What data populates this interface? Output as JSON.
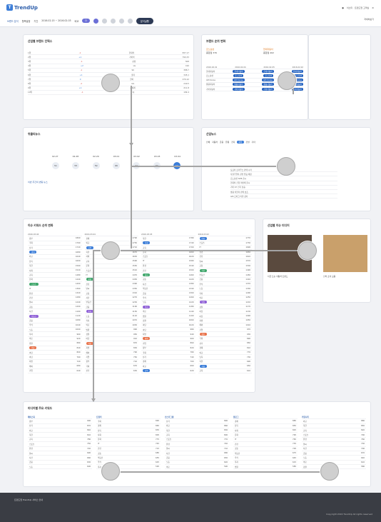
{
  "header": {
    "app_name": "TrendUp",
    "user_text": "이소미 · 트렌드업 고객님",
    "right_link": "자세히보기",
    "filter_category": "브랜드 분석",
    "filter_sub": "항목설정",
    "date_label": "기간",
    "date_range": "2016.02.15 ~ 2016.02.03",
    "ref_label": "비교",
    "analyze_btn": "분석실행"
  },
  "brand_card": {
    "title": "산업별 브랜드 인덱스",
    "rows": [
      {
        "rank": "1위",
        "change": "-1",
        "brand": "현대차",
        "score": "837.17"
      },
      {
        "rank": "2위",
        "change": "+1",
        "brand": "기아차",
        "score": "790.33"
      },
      {
        "rank": "3위",
        "change": "-1",
        "brand": "삼성",
        "score": "508"
      },
      {
        "rank": "4위",
        "change": "+2",
        "brand": "LG",
        "score": "410"
      },
      {
        "rank": "5위",
        "change": "-1",
        "brand": "SK",
        "score": "388.7"
      },
      {
        "rank": "6위",
        "change": "+1",
        "brand": "롯데",
        "score": "345.1"
      },
      {
        "rank": "7위",
        "change": "0",
        "brand": "한화",
        "score": "279.12"
      },
      {
        "rank": "8위",
        "change": "-2",
        "brand": "GS",
        "score": "240.5"
      },
      {
        "rank": "9위",
        "change": "+1",
        "brand": "신세계",
        "score": "211.8"
      },
      {
        "rank": "10위",
        "change": "-1",
        "brand": "CJ",
        "score": "199.4"
      }
    ]
  },
  "compare_card": {
    "title": "브랜드 순위 변화",
    "brand_a": "르노삼성",
    "score_a": "종합점 376",
    "brand_b": "현대자동차",
    "score_b": "종합점 402",
    "cols": [
      "2016.02.01",
      "2016.02.04",
      "2016.02.05",
      "2016.02.02"
    ],
    "rows": [
      "현대자동차",
      "르노삼성",
      "GM Korea",
      "쌍용자동차",
      "기아자동차"
    ]
  },
  "keyword_card": {
    "title": "위클리뉴스",
    "chart_labels": [
      "02.27",
      "02.28",
      "02.29",
      "03.01",
      "03.02",
      "03.03",
      "03.04"
    ],
    "values": [
      "51",
      "55",
      "59",
      "66",
      "41",
      "30",
      "11"
    ],
    "text_head": "이번 주간의 변동 뉴스"
  },
  "news_card": {
    "title": "산업뉴스",
    "tabs": [
      "전체",
      "자동차",
      "금융",
      "유통",
      "전자",
      "화학",
      "건설",
      "기타"
    ],
    "items": [
      "토요타 프리우스 판매 시작",
      "자율주행차 관련 발표 예정",
      "르노삼성 SM6 출시",
      "현대차 신형 아반떼 출시",
      "기아 K7 인기 상승",
      "쌍용 티볼리 판매 호조",
      "GM 스파크 리콜 공지"
    ]
  },
  "rank_card": {
    "title": "이슈 키워드 순위 변화",
    "cols": [
      "2016.03.04",
      "2016.03.04",
      "2016.03.03",
      "2016.03.02"
    ]
  },
  "media_card": {
    "title": "산업별 이슈 미디어",
    "cap_a": "지금 뜨는 자동차 트렌드",
    "cap_b": "신차 소식 모음"
  },
  "bottom_card": {
    "title": "미디어별 주요 키워드",
    "groups": [
      "페이스북",
      "트위터",
      "인스타그램",
      "블로그",
      "커뮤니티"
    ]
  },
  "footer": {
    "note": "트렌드업 TrendUp 서비스 안내",
    "copyright": "Copyright 2016 TrendUp All rights reserved"
  }
}
